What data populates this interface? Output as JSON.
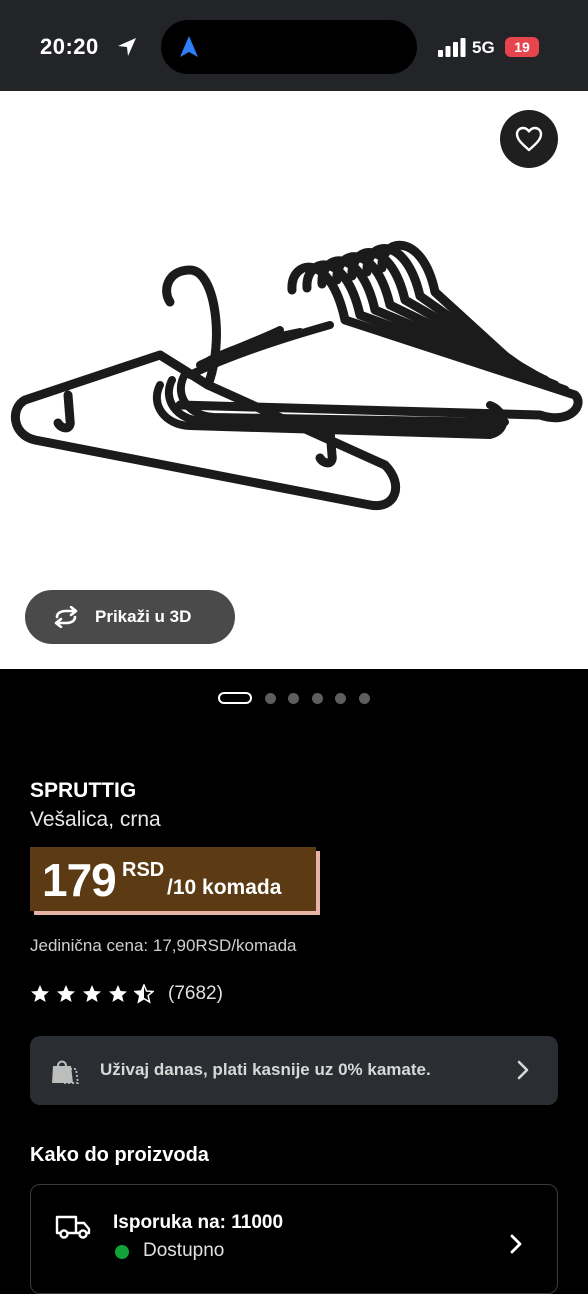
{
  "status_bar": {
    "time": "20:20",
    "network": "5G",
    "battery": "19"
  },
  "product": {
    "brand": "SPRUTTIG",
    "description": "Vešalica, crna",
    "price_value": "179",
    "price_currency": "RSD",
    "price_unit": "/10 komada",
    "unit_price": "Jedinična cena: 17,90RSD/komada",
    "rating_count": "(7682)",
    "rating_stars": 4.5
  },
  "viewer": {
    "button_3d_label": "Prikaži u 3D",
    "active_slide": 1,
    "total_slides": 6
  },
  "promo": {
    "text": "Uživaj danas, plati kasnije uz 0% kamate."
  },
  "delivery": {
    "section_title": "Kako do proizvoda",
    "title": "Isporuka na: 11000",
    "availability": "Dostupno"
  },
  "colors": {
    "price_bg": "#5b3a14",
    "price_shadow": "#e7b3a6",
    "available": "#10a33a",
    "battery": "#e6454e"
  },
  "icons": [
    "location-arrow-icon",
    "navigation-icon",
    "signal-icon",
    "heart-icon",
    "rotate-3d-icon",
    "star-icon",
    "payment-bag-icon",
    "chevron-right-icon",
    "truck-icon"
  ]
}
